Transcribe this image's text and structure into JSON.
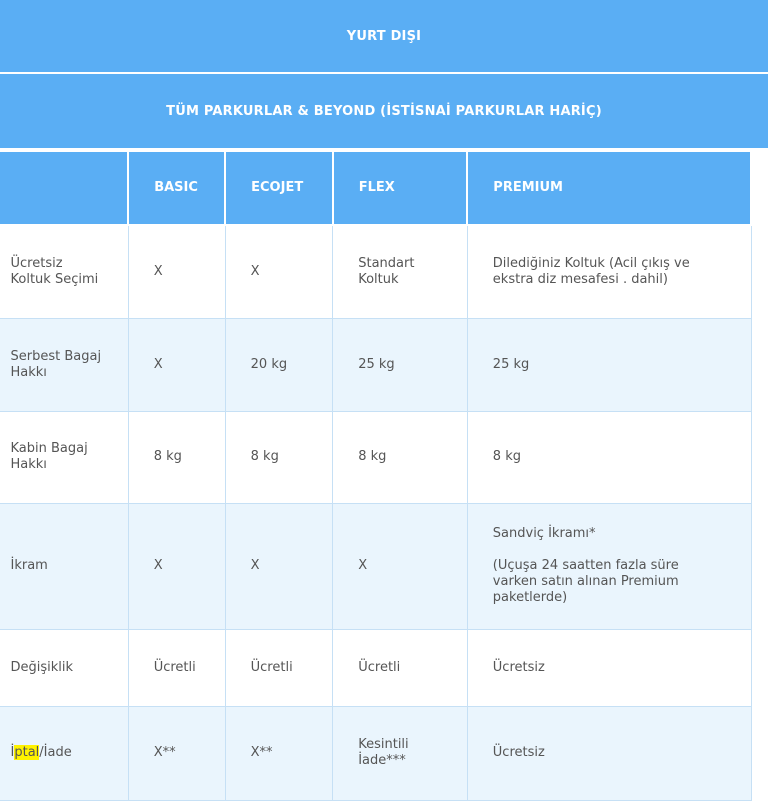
{
  "banner": {
    "region": "YURT DIŞI",
    "routes": "TÜM PARKURLAR & BEYOND (İSTİSNAİ PARKURLAR HARİÇ)"
  },
  "table": {
    "columns": [
      "",
      "BASIC",
      "ECOJET",
      "FLEX",
      "PREMIUM"
    ],
    "rows": [
      {
        "feature": "Ücretsiz Koltuk Seçimi",
        "basic": "X",
        "ecojet": "X",
        "flex": "Standart Koltuk",
        "premium": "Dilediğiniz Koltuk (Acil çıkış ve ekstra diz mesafesi . dahil)"
      },
      {
        "feature": "Serbest Bagaj Hakkı",
        "basic": "X",
        "ecojet": "20 kg",
        "flex": "25 kg",
        "premium": "25 kg"
      },
      {
        "feature": "Kabin Bagaj Hakkı",
        "basic": "8 kg",
        "ecojet": "8 kg",
        "flex": "8 kg",
        "premium": "8 kg"
      },
      {
        "feature": "İkram",
        "basic": "X",
        "ecojet": "X",
        "flex": "X",
        "premium_main": "Sandviç İkramı*",
        "premium_note": "(Uçuşa 24 saatten fazla süre varken satın alınan Premium paketlerde)"
      },
      {
        "feature": "Değişiklik",
        "basic": "Ücretli",
        "ecojet": "Ücretli",
        "flex": "Ücretli",
        "premium": "Ücretsiz"
      },
      {
        "feature_prefix": "İ",
        "feature_highlight": "ptal",
        "feature_suffix": "/İade",
        "basic": "X**",
        "ecojet": "X**",
        "flex": "Kesintili İade***",
        "premium": "Ücretsiz"
      }
    ]
  },
  "colors": {
    "header_blue": "#5aaef4",
    "alt_row": "#eaf5fd",
    "highlight": "#fff200"
  }
}
